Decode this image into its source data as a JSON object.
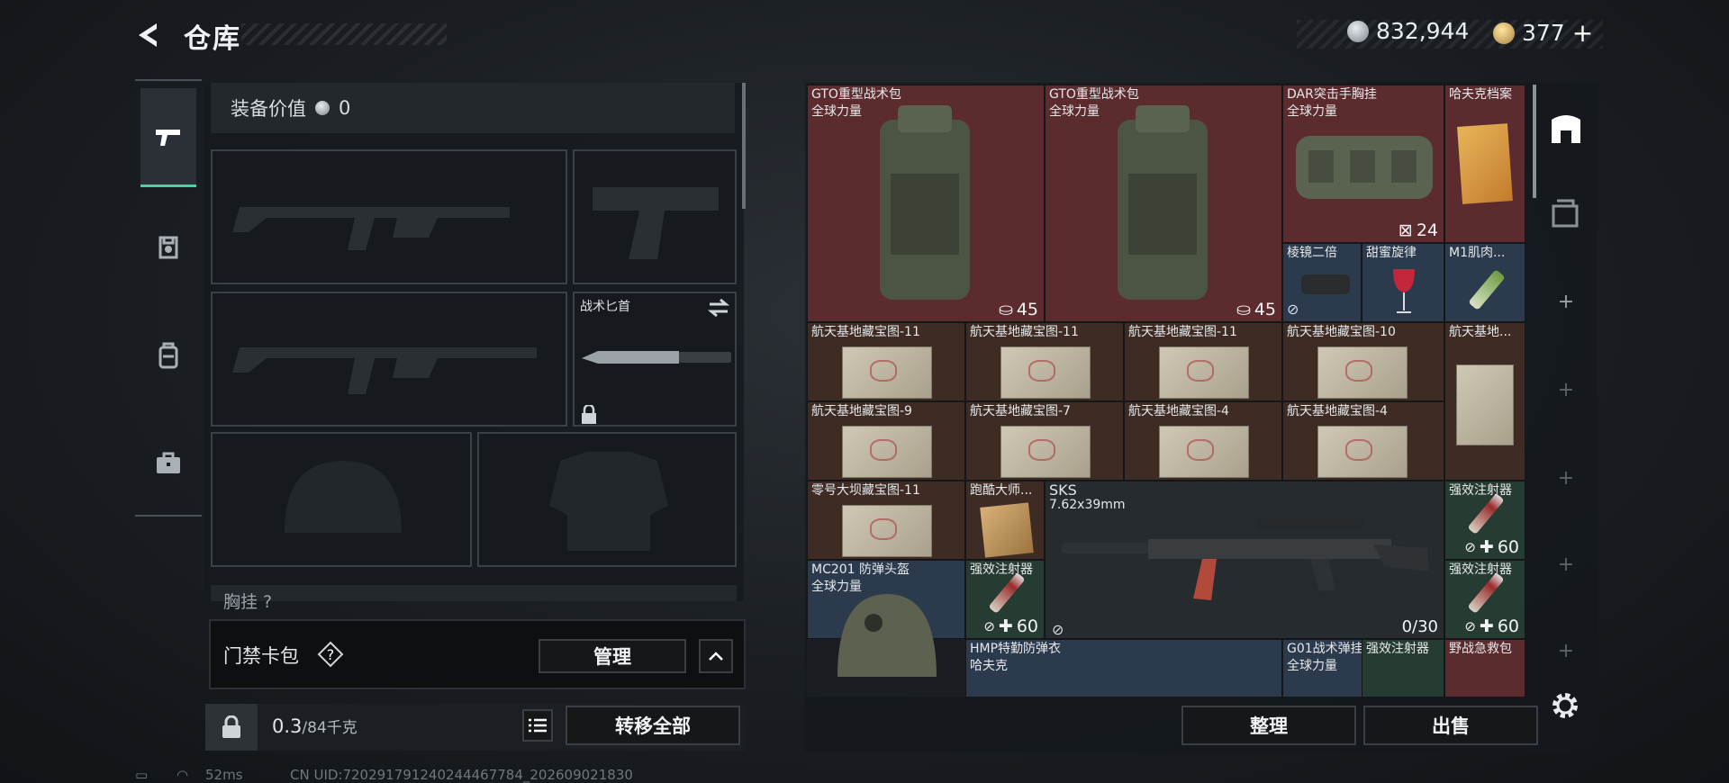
{
  "header": {
    "title": "仓库",
    "currency": [
      {
        "icon": "silver-coin-icon",
        "value": "832,944"
      },
      {
        "icon": "gold-coin-icon",
        "value": "377"
      }
    ],
    "add_label": "+"
  },
  "left_tabs": [
    "pistol-icon",
    "armor-icon",
    "backpack-icon",
    "briefcase-icon"
  ],
  "equipment": {
    "value_label": "装备价值",
    "value": "0",
    "slots": [
      {
        "label": "",
        "kind": "primary-rifle-1"
      },
      {
        "label": "",
        "kind": "pistol"
      },
      {
        "label": "",
        "kind": "primary-rifle-2"
      },
      {
        "label": "战术匕首",
        "kind": "melee"
      },
      {
        "label": "",
        "kind": "helmet"
      },
      {
        "label": "",
        "kind": "body-armor"
      }
    ],
    "chest_label": "胸挂 ?"
  },
  "keycard": {
    "title": "门禁卡包",
    "help": "?",
    "manage_label": "管理",
    "collapse_label": "^"
  },
  "weight": {
    "current": "0.3",
    "max_text": "/84千克",
    "transfer_label": "转移全部"
  },
  "status": {
    "ping": "52ms",
    "uid": "CN UID:720291791240244467784_202609021830"
  },
  "stash": {
    "items": [
      {
        "name": "GTO重型战术包",
        "sub": "全球力量",
        "count": "45"
      },
      {
        "name": "GTO重型战术包",
        "sub": "全球力量",
        "count": "45"
      },
      {
        "name": "DAR突击手胸挂",
        "sub": "全球力量",
        "count": "24"
      },
      {
        "name": "哈夫克档案",
        "sub": "",
        "count": ""
      },
      {
        "name": "棱镜二倍",
        "sub": "",
        "count": ""
      },
      {
        "name": "甜蜜旋律",
        "sub": "",
        "count": ""
      },
      {
        "name": "M1肌肉...",
        "sub": "",
        "count": ""
      },
      {
        "name": "航天基地藏宝图-11",
        "sub": "",
        "count": ""
      },
      {
        "name": "航天基地藏宝图-11",
        "sub": "",
        "count": ""
      },
      {
        "name": "航天基地藏宝图-11",
        "sub": "",
        "count": ""
      },
      {
        "name": "航天基地藏宝图-10",
        "sub": "",
        "count": ""
      },
      {
        "name": "航天基地...",
        "sub": "",
        "count": ""
      },
      {
        "name": "航天基地藏宝图-9",
        "sub": "",
        "count": ""
      },
      {
        "name": "航天基地藏宝图-7",
        "sub": "",
        "count": ""
      },
      {
        "name": "航天基地藏宝图-4",
        "sub": "",
        "count": ""
      },
      {
        "name": "航天基地藏宝图-4",
        "sub": "",
        "count": ""
      },
      {
        "name": "零号大坝藏宝图-11",
        "sub": "",
        "count": ""
      },
      {
        "name": "跑酷大师...",
        "sub": "",
        "count": ""
      },
      {
        "name": "SKS",
        "sub": "7.62x39mm",
        "count": "0/30"
      },
      {
        "name": "强效注射器",
        "sub": "",
        "count": "60"
      },
      {
        "name": "MC201 防弹头盔",
        "sub": "全球力量",
        "count": ""
      },
      {
        "name": "强效注射器",
        "sub": "",
        "count": "60"
      },
      {
        "name": "强效注射器",
        "sub": "",
        "count": "60"
      },
      {
        "name": "HMP特勤防弹衣",
        "sub": "哈夫克",
        "count": ""
      },
      {
        "name": "G01战术弹挂",
        "sub": "全球力量",
        "count": ""
      },
      {
        "name": "强效注射器",
        "sub": "",
        "count": ""
      },
      {
        "name": "野战急救包",
        "sub": "",
        "count": ""
      }
    ]
  },
  "actions": {
    "arrange_label": "整理",
    "sell_label": "出售"
  },
  "colors": {
    "accent": "#3fd8a3",
    "rarity_red": "#5c2b2e",
    "rarity_blue": "#2b3a4c",
    "rarity_green": "#263c33"
  }
}
